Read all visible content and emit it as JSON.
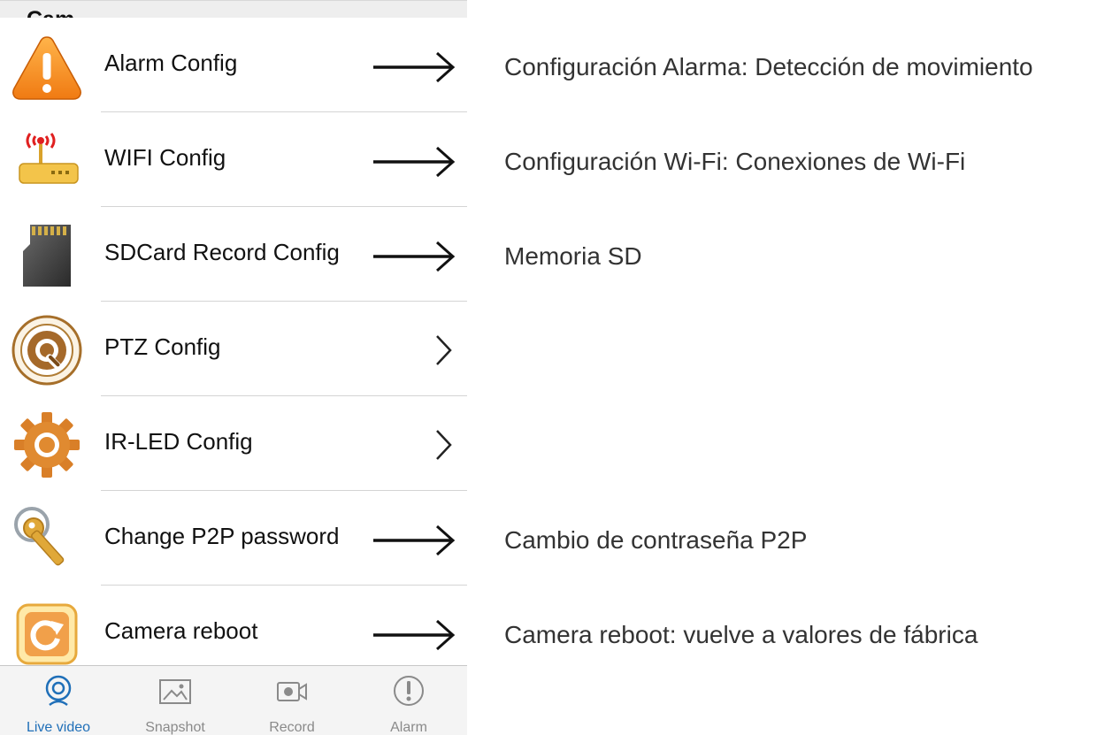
{
  "section": {
    "title": "Cam"
  },
  "rows": [
    {
      "label": "Alarm Config"
    },
    {
      "label": "WIFI Config"
    },
    {
      "label": "SDCard Record Config"
    },
    {
      "label": "PTZ Config"
    },
    {
      "label": "IR-LED Config"
    },
    {
      "label": "Change P2P password"
    },
    {
      "label": "Camera reboot"
    }
  ],
  "annotations": [
    "Configuración Alarma: Detección de movimiento",
    "Configuración Wi-Fi: Conexiones de Wi-Fi",
    "Memoria SD",
    "Cambio de contraseña P2P",
    "Camera reboot: vuelve a valores de fábrica"
  ],
  "tabs": [
    {
      "label": "Live video",
      "icon": "live-video-icon",
      "active": true
    },
    {
      "label": "Snapshot",
      "icon": "snapshot-icon",
      "active": false
    },
    {
      "label": "Record",
      "icon": "record-icon",
      "active": false
    },
    {
      "label": "Alarm",
      "icon": "alarm-icon",
      "active": false
    }
  ],
  "colors": {
    "active_tab": "#1f6fb8",
    "inactive_tab": "#8a8a8a",
    "separator": "#d4d4d4"
  }
}
